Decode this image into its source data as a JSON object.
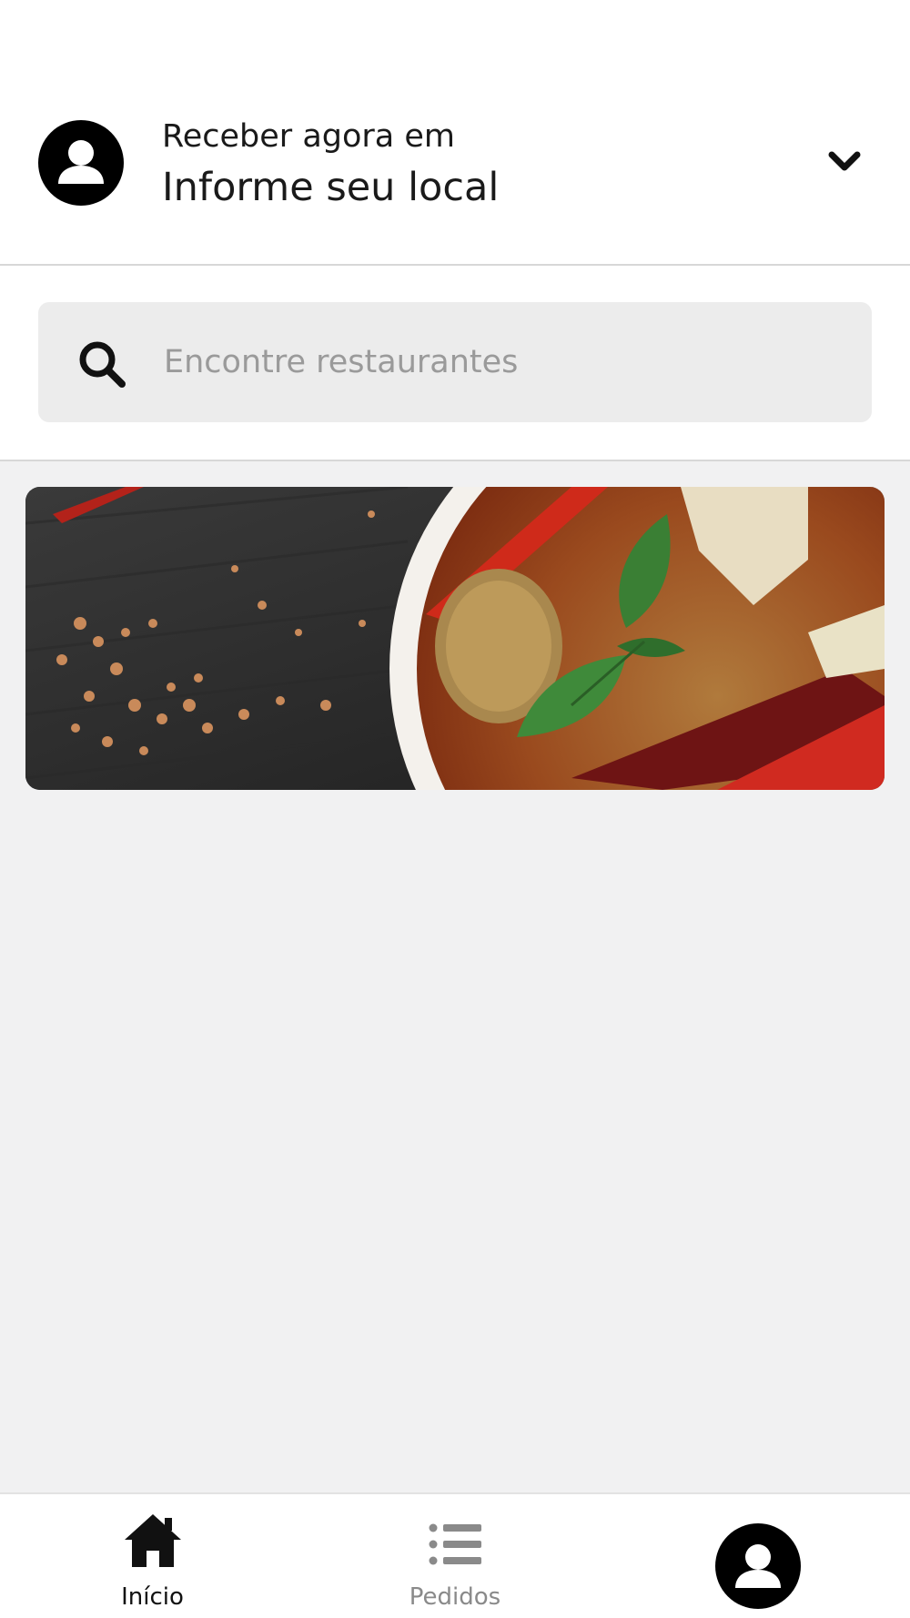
{
  "location": {
    "label": "Receber agora em",
    "value": "Informe seu local",
    "avatar_icon": "user-avatar-icon",
    "chevron_icon": "chevron-down-icon"
  },
  "search": {
    "placeholder": "Encontre restaurantes",
    "value": "",
    "icon": "search-icon"
  },
  "banner": {
    "image": "food-banner-image"
  },
  "bottom_nav": {
    "items": [
      {
        "label": "Início",
        "icon": "home-icon",
        "active": true
      },
      {
        "label": "Pedidos",
        "icon": "list-icon",
        "active": false
      },
      {
        "label": "",
        "icon": "profile-avatar-icon",
        "active": false
      }
    ]
  },
  "colors": {
    "background": "#ffffff",
    "content_background": "#f1f1f2",
    "search_background": "#ececec",
    "text_primary": "#1a1a1a",
    "text_muted": "#9a9a9a",
    "nav_active": "#111111",
    "nav_inactive": "#8a8a8a"
  }
}
